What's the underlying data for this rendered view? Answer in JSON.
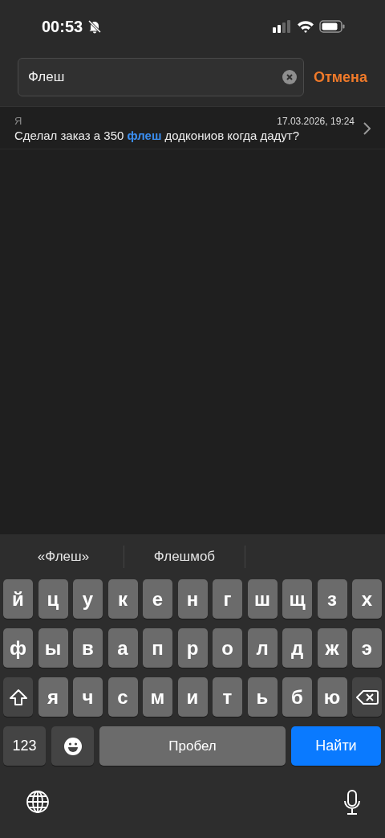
{
  "status_bar": {
    "time": "00:53",
    "silent": true
  },
  "search": {
    "value": "Флеш",
    "cancel": "Отмена"
  },
  "results": [
    {
      "sender": "Я",
      "date": "17.03.2026, 19:24",
      "text_before": "Сделал заказ а 350 ",
      "match": "флеш",
      "text_after": " додкониов когда дадут?"
    }
  ],
  "keyboard": {
    "suggestions": [
      "«Флеш»",
      "Флешмоб"
    ],
    "rows": [
      [
        {
          "kind": "letter",
          "label": "й"
        },
        {
          "kind": "letter",
          "label": "ц"
        },
        {
          "kind": "letter",
          "label": "у"
        },
        {
          "kind": "letter",
          "label": "к"
        },
        {
          "kind": "letter",
          "label": "е"
        },
        {
          "kind": "letter",
          "label": "н"
        },
        {
          "kind": "letter",
          "label": "г"
        },
        {
          "kind": "letter",
          "label": "ш"
        },
        {
          "kind": "letter",
          "label": "щ"
        },
        {
          "kind": "letter",
          "label": "з"
        },
        {
          "kind": "letter",
          "label": "х"
        }
      ],
      [
        {
          "kind": "letter",
          "label": "ф"
        },
        {
          "kind": "letter",
          "label": "ы"
        },
        {
          "kind": "letter",
          "label": "в"
        },
        {
          "kind": "letter",
          "label": "а"
        },
        {
          "kind": "letter",
          "label": "п"
        },
        {
          "kind": "letter",
          "label": "р"
        },
        {
          "kind": "letter",
          "label": "о"
        },
        {
          "kind": "letter",
          "label": "л"
        },
        {
          "kind": "letter",
          "label": "д"
        },
        {
          "kind": "letter",
          "label": "ж"
        },
        {
          "kind": "letter",
          "label": "э"
        }
      ],
      [
        {
          "kind": "shift"
        },
        {
          "kind": "letter",
          "label": "я"
        },
        {
          "kind": "letter",
          "label": "ч"
        },
        {
          "kind": "letter",
          "label": "с"
        },
        {
          "kind": "letter",
          "label": "м"
        },
        {
          "kind": "letter",
          "label": "и"
        },
        {
          "kind": "letter",
          "label": "т"
        },
        {
          "kind": "letter",
          "label": "ь"
        },
        {
          "kind": "letter",
          "label": "б"
        },
        {
          "kind": "letter",
          "label": "ю"
        },
        {
          "kind": "delete"
        }
      ]
    ],
    "numbers": "123",
    "space": "Пробел",
    "action": "Найти"
  }
}
